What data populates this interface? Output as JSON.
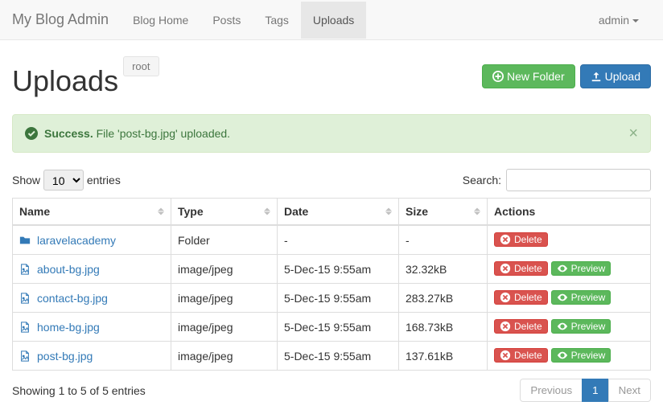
{
  "nav": {
    "brand": "My Blog Admin",
    "items": [
      "Blog Home",
      "Posts",
      "Tags",
      "Uploads"
    ],
    "active_index": 3,
    "user": "admin"
  },
  "header": {
    "title": "Uploads",
    "breadcrumb": "root",
    "new_folder": "New Folder",
    "upload": "Upload"
  },
  "alert": {
    "strong": "Success.",
    "text": "File 'post-bg.jpg' uploaded."
  },
  "table_controls": {
    "show_label": "Show",
    "entries_label": "entries",
    "page_size": "10",
    "search_label": "Search:"
  },
  "columns": [
    "Name",
    "Type",
    "Date",
    "Size",
    "Actions"
  ],
  "rows": [
    {
      "icon": "folder",
      "name": "laravelacademy",
      "type": "Folder",
      "date": "-",
      "size": "-",
      "preview": false
    },
    {
      "icon": "file",
      "name": "about-bg.jpg",
      "type": "image/jpeg",
      "date": "5-Dec-15 9:55am",
      "size": "32.32kB",
      "preview": true
    },
    {
      "icon": "file",
      "name": "contact-bg.jpg",
      "type": "image/jpeg",
      "date": "5-Dec-15 9:55am",
      "size": "283.27kB",
      "preview": true
    },
    {
      "icon": "file",
      "name": "home-bg.jpg",
      "type": "image/jpeg",
      "date": "5-Dec-15 9:55am",
      "size": "168.73kB",
      "preview": true
    },
    {
      "icon": "file",
      "name": "post-bg.jpg",
      "type": "image/jpeg",
      "date": "5-Dec-15 9:55am",
      "size": "137.61kB",
      "preview": true
    }
  ],
  "actions": {
    "delete": "Delete",
    "preview": "Preview"
  },
  "footer": {
    "info": "Showing 1 to 5 of 5 entries",
    "previous": "Previous",
    "next": "Next",
    "page": "1"
  }
}
